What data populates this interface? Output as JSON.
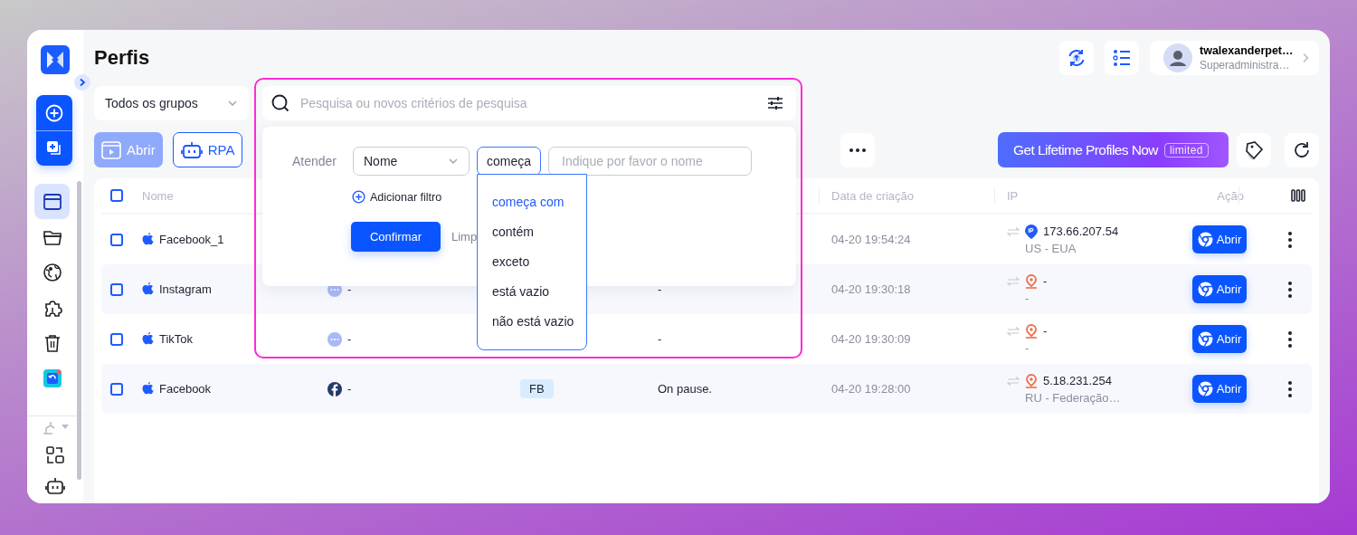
{
  "sidebar": {
    "nav_items": [
      {
        "selected": true
      },
      {
        "selected": false
      },
      {
        "selected": false
      },
      {
        "selected": false
      },
      {
        "selected": false
      },
      {
        "selected": false
      }
    ]
  },
  "header": {
    "title": "Perfis",
    "user": {
      "name": "twalexanderpet…",
      "role": "Superadministra…"
    }
  },
  "group_select": "Todos os grupos",
  "toolbar": {
    "buttons": [
      {
        "label": "Abrir",
        "disabled": true
      },
      {
        "label": "RPA",
        "disabled": false
      }
    ],
    "promo": {
      "text": "Get Lifetime Profiles Now",
      "badge": "limited"
    }
  },
  "table": {
    "header_checked": false,
    "columns": {
      "name": "Nome",
      "created": "Data de criação",
      "ip": "IP",
      "action": "Ação"
    },
    "rows": [
      {
        "checked": false,
        "name": "Facebook_1",
        "created": "04-20 19:54:24",
        "ip_icon": {
          "kind": "ip"
        },
        "ip": "173.66.207.54",
        "location": "US - EUA",
        "action": "Abrir"
      },
      {
        "checked": false,
        "name": "Instagram",
        "avatar": {
          "kind": "dots"
        },
        "profile": "-",
        "note": "-",
        "created": "04-20 19:30:18",
        "ip_icon": {
          "kind": "pin"
        },
        "ip": "-",
        "location": "-",
        "action": "Abrir"
      },
      {
        "checked": false,
        "name": "TikTok",
        "avatar": {
          "kind": "dots"
        },
        "profile": "-",
        "note": "-",
        "created": "04-20 19:30:09",
        "ip_icon": {
          "kind": "pin"
        },
        "ip": "-",
        "location": "-",
        "action": "Abrir"
      },
      {
        "checked": false,
        "name": "Facebook",
        "avatar": {
          "kind": "facebook"
        },
        "profile": "-",
        "tag": "FB",
        "note": "On pause.",
        "created": "04-20 19:28:00",
        "ip_icon": {
          "kind": "pin"
        },
        "ip": "5.18.231.254",
        "location": "RU - Federação…",
        "action": "Abrir"
      }
    ]
  },
  "filter": {
    "search_placeholder": "Pesquisa ou novos critérios de pesquisa",
    "match_label": "Atender",
    "field": "Nome",
    "operator": "começa",
    "value_placeholder": "Indique por favor o nome",
    "add_filter": "Adicionar filtro",
    "confirm": "Confirmar",
    "clear": "Limp",
    "options": [
      {
        "label": "começa com",
        "selected": true
      },
      {
        "label": "contém",
        "selected": false
      },
      {
        "label": "exceto",
        "selected": false
      },
      {
        "label": "está vazio",
        "selected": false
      },
      {
        "label": "não está vazio",
        "selected": false
      }
    ]
  }
}
